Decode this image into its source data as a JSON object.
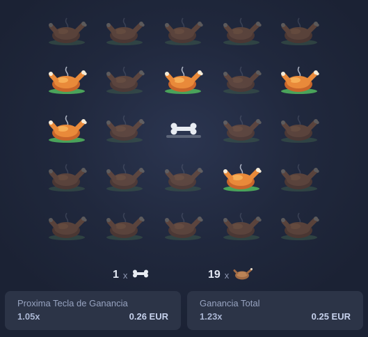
{
  "board": {
    "rows": [
      [
        "hidden",
        "hidden",
        "hidden",
        "hidden",
        "hidden"
      ],
      [
        "chicken",
        "hidden",
        "chicken",
        "hidden",
        "chicken"
      ],
      [
        "chicken",
        "hidden",
        "bone",
        "hidden",
        "hidden"
      ],
      [
        "hidden",
        "hidden",
        "hidden",
        "chicken",
        "hidden"
      ],
      [
        "hidden",
        "hidden",
        "hidden",
        "hidden",
        "hidden"
      ]
    ]
  },
  "counters": {
    "bones": {
      "count": "1",
      "multiplier_sign": "x",
      "icon": "bone-icon"
    },
    "chickens": {
      "count": "19",
      "multiplier_sign": "x",
      "icon": "chicken-icon"
    }
  },
  "next_win": {
    "title": "Proxima Tecla de Ganancia",
    "multiplier": "1.05x",
    "amount": "0.26 EUR"
  },
  "total_win": {
    "title": "Ganancia Total",
    "multiplier": "1.23x",
    "amount": "0.25 EUR"
  },
  "colors": {
    "background": "#20283d",
    "panel": "#2c3447",
    "chicken_revealed": "#e98a3a",
    "chicken_hidden": "#8a5a3c",
    "lettuce": "#4aa35a"
  }
}
